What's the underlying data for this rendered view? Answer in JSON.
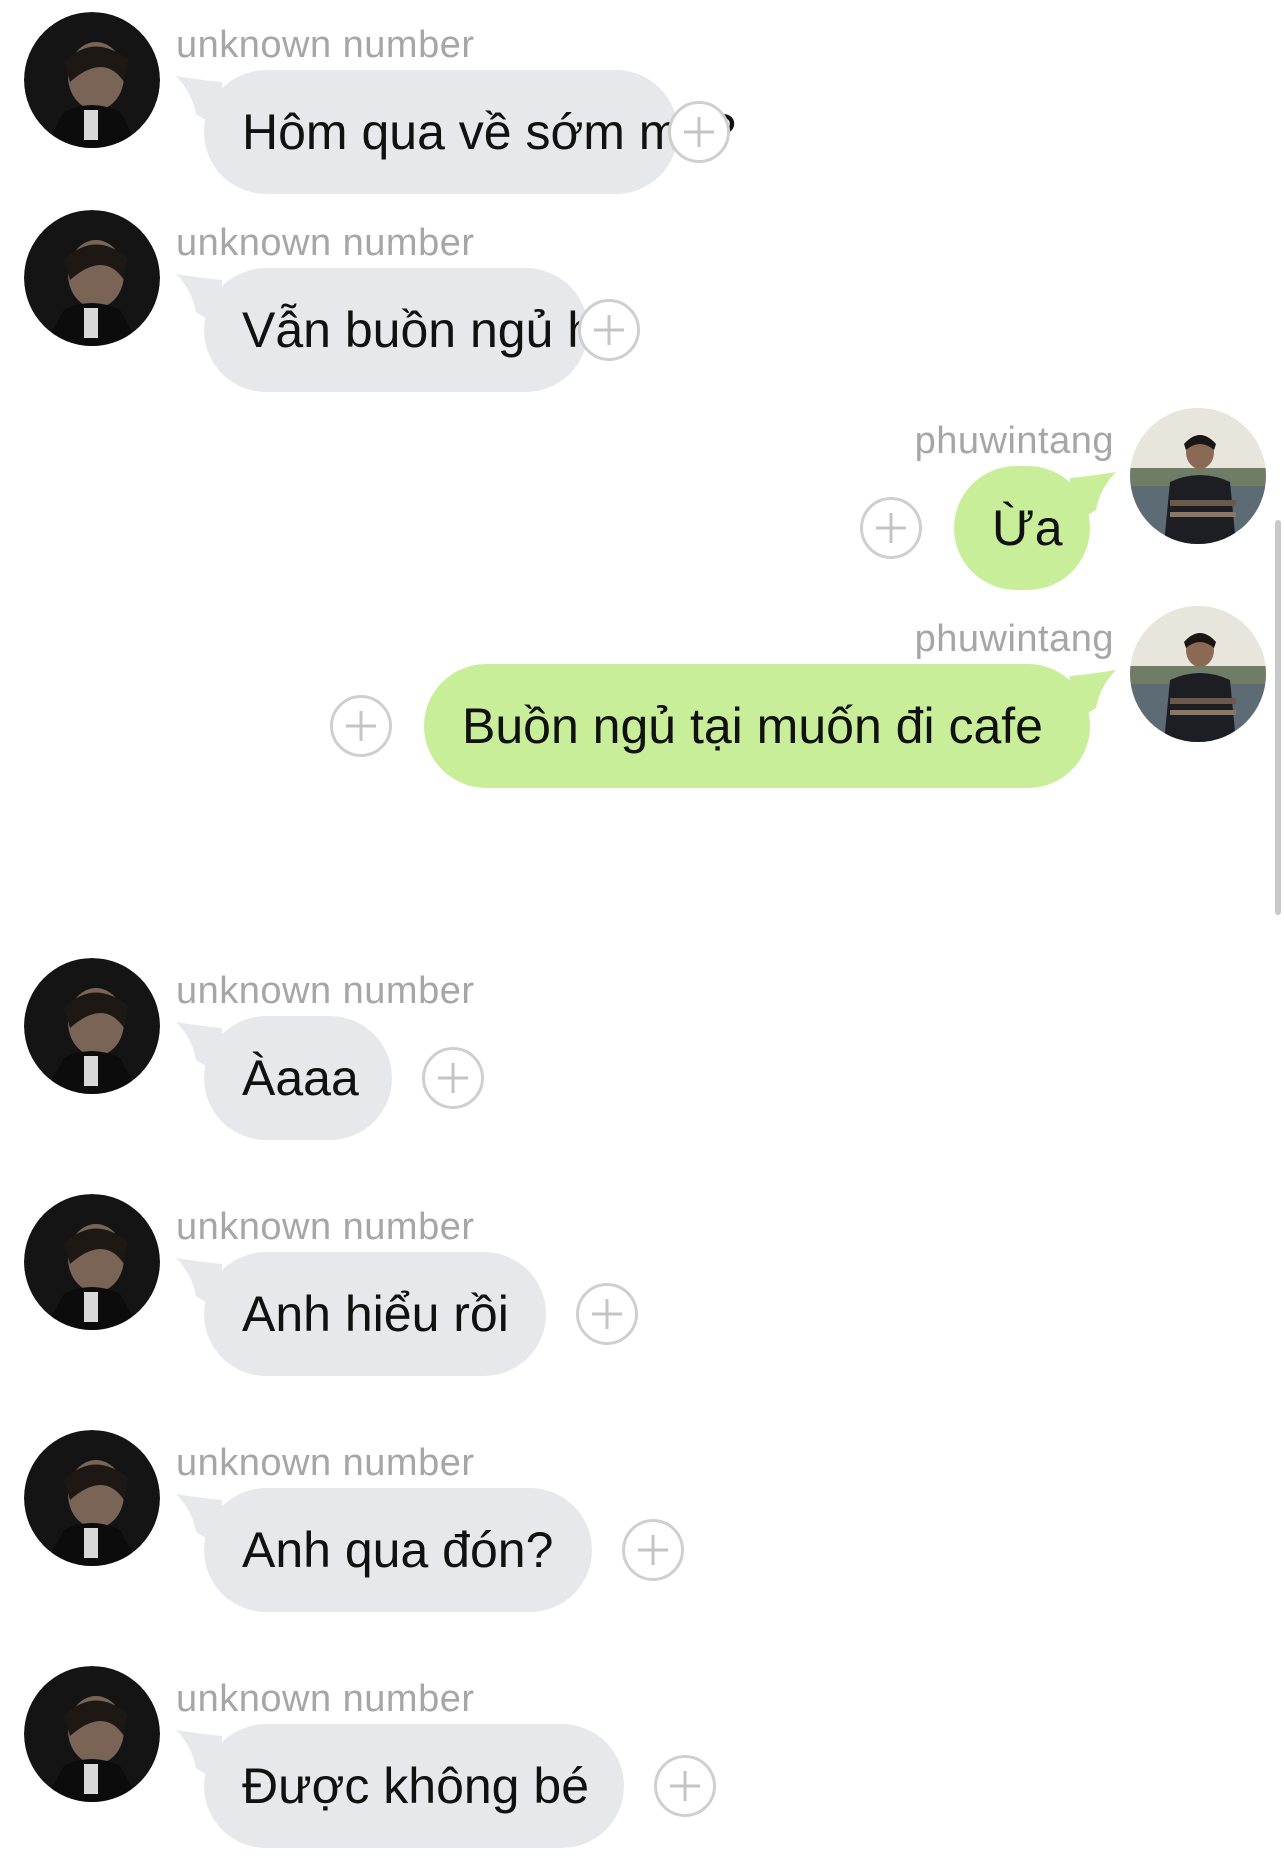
{
  "messages": [
    {
      "direction": "in",
      "sender": "unknown number",
      "text": "Hôm qua về sớm mà?"
    },
    {
      "direction": "in",
      "sender": "unknown number",
      "text": "Vẫn buồn ngủ hả"
    },
    {
      "direction": "out",
      "sender": "phuwintang",
      "text": "Ừa"
    },
    {
      "direction": "out",
      "sender": "phuwintang",
      "text": "Buồn ngủ tại muốn đi cafe"
    },
    {
      "direction": "in",
      "sender": "unknown number",
      "text": "Àaaa"
    },
    {
      "direction": "in",
      "sender": "unknown number",
      "text": "Anh hiểu rồi"
    },
    {
      "direction": "in",
      "sender": "unknown number",
      "text": "Anh qua đón?"
    },
    {
      "direction": "in",
      "sender": "unknown number",
      "text": "Được không bé"
    }
  ],
  "icons": {
    "add_reaction": "plus-circle-icon",
    "avatar_incoming": "avatar-dark-portrait",
    "avatar_outgoing": "avatar-lakeside-portrait"
  },
  "colors": {
    "incoming_bubble": "#e6e8ec",
    "outgoing_bubble": "#c8ee9a",
    "sender_label": "#a6a6a6",
    "message_text": "#111111"
  }
}
